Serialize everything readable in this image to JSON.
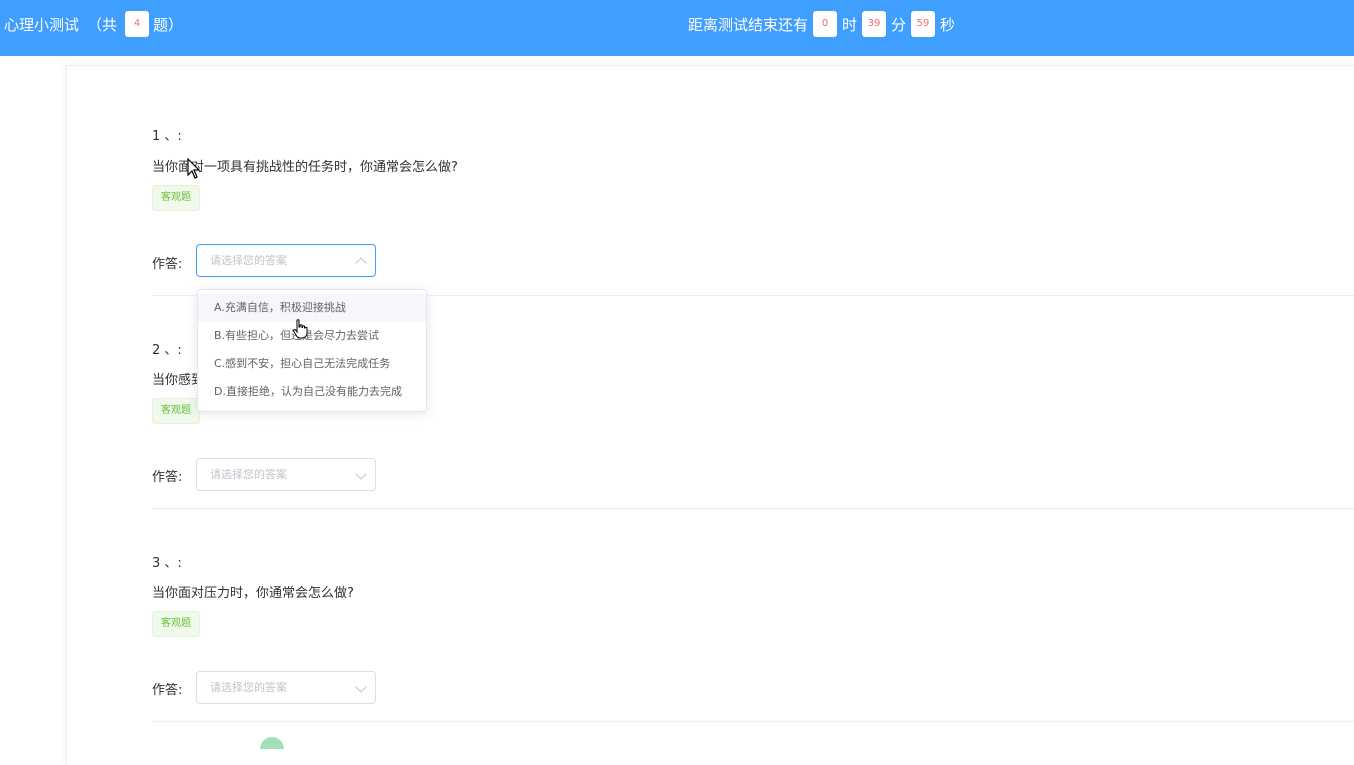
{
  "header": {
    "title": "心理小测试",
    "total_prefix": "（共",
    "total_count": "4",
    "total_suffix": "题）",
    "timer_label": "距离测试结束还有",
    "hours": "0",
    "hours_unit": "时",
    "minutes": "39",
    "minutes_unit": "分",
    "seconds": "59",
    "seconds_unit": "秒"
  },
  "questions": [
    {
      "number": "1 、:",
      "text": "当你面对一项具有挑战性的任务时，你通常会怎么做?",
      "tag": "客观题",
      "answer_label": "作答:",
      "placeholder": "请选择您的答案"
    },
    {
      "number": "2 、:",
      "text": "当你感到",
      "tag": "客观题",
      "answer_label": "作答:",
      "placeholder": "请选择您的答案"
    },
    {
      "number": "3 、:",
      "text": "当你面对压力时，你通常会怎么做?",
      "tag": "客观题",
      "answer_label": "作答:",
      "placeholder": "请选择您的答案"
    }
  ],
  "dropdown_options": [
    "A.充满自信，积极迎接挑战",
    "B.有些担心，但还是会尽力去尝试",
    "C.感到不安，担心自己无法完成任务",
    "D.直接拒绝，认为自己没有能力去完成"
  ]
}
